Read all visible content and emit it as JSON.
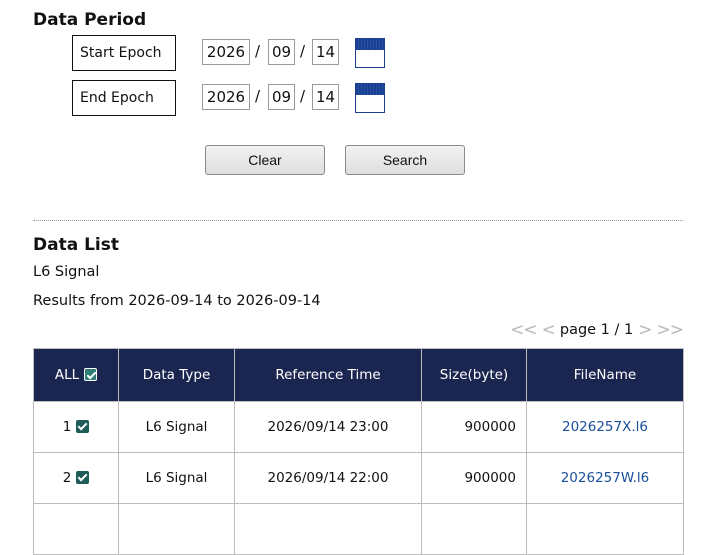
{
  "period": {
    "heading": "Data Period",
    "start": {
      "label": "Start Epoch",
      "year": "2026",
      "month": "09",
      "day": "14"
    },
    "end": {
      "label": "End Epoch",
      "year": "2026",
      "month": "09",
      "day": "14"
    },
    "date_separator": "/",
    "clear_label": "Clear",
    "search_label": "Search"
  },
  "list": {
    "heading": "Data List",
    "subtitle": "L6 Signal",
    "results_text": "Results from 2026-09-14 to 2026-09-14",
    "pager": {
      "first": "<<",
      "prev": "<",
      "text": "page 1 / 1",
      "next": ">",
      "last": ">>"
    },
    "columns": {
      "all": "ALL",
      "type": "Data Type",
      "ref_time": "Reference Time",
      "size": "Size(byte)",
      "file": "FileName"
    },
    "rows": [
      {
        "index": "1",
        "type": "L6 Signal",
        "ref_time": "2026/09/14 23:00",
        "size": "900000",
        "file": "2026257X.l6",
        "checked": true
      },
      {
        "index": "2",
        "type": "L6 Signal",
        "ref_time": "2026/09/14 22:00",
        "size": "900000",
        "file": "2026257W.l6",
        "checked": true
      }
    ]
  },
  "colors": {
    "header_bg": "#1b2650",
    "checkbox": "#1d5c57",
    "link": "#1a4f9c",
    "calendar": "#1a3f8f"
  }
}
